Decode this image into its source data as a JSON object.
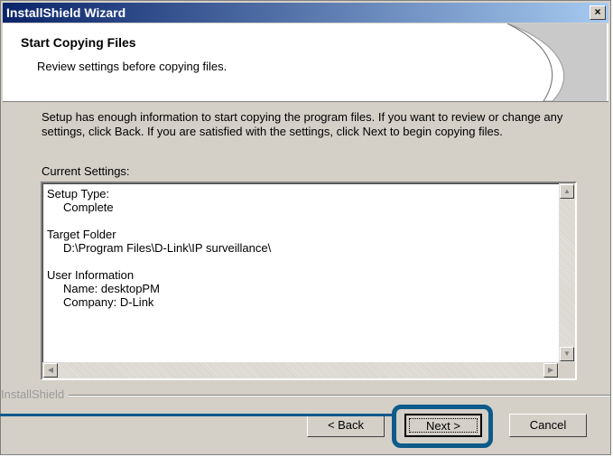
{
  "window": {
    "title": "InstallShield Wizard",
    "close_label": "×"
  },
  "header": {
    "title": "Start Copying Files",
    "subtitle": "Review settings before copying files."
  },
  "body": {
    "description": "Setup has enough information to start copying the program files.  If you want to review or change any settings, click Back.  If you are satisfied with the settings, click Next to begin copying files.",
    "current_settings_label": "Current Settings:",
    "settings": [
      {
        "heading": "Setup Type:",
        "values": [
          "Complete"
        ]
      },
      {
        "heading": "Target Folder",
        "values": [
          "D:\\Program Files\\D-Link\\IP surveillance\\"
        ]
      },
      {
        "heading": "User Information",
        "values": [
          "Name: desktopPM",
          "Company: D-Link"
        ]
      }
    ]
  },
  "footer": {
    "brand": "InstallShield",
    "back_label": "< Back",
    "next_label": "Next >",
    "cancel_label": "Cancel"
  },
  "colors": {
    "accent": "#0e5a8a",
    "title_start": "#0a246a",
    "title_end": "#a6caf0"
  }
}
